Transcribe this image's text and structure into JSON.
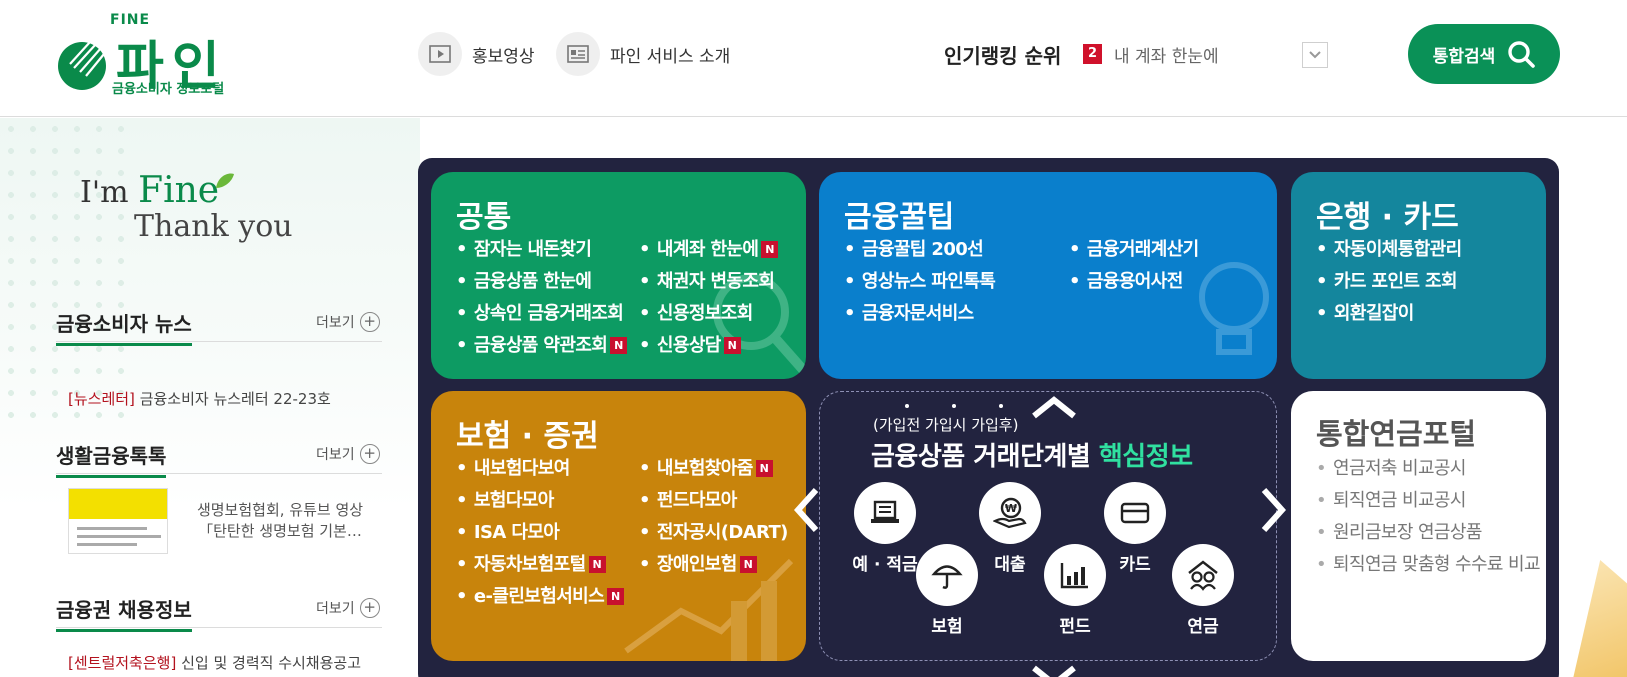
{
  "logo": {
    "top": "FINE",
    "name": "파인",
    "sub": "금융소비자 정보포털"
  },
  "nav": {
    "promo_video": "홍보영상",
    "service_intro": "파인 서비스 소개"
  },
  "ranking": {
    "title": "인기랭킹 순위",
    "num": "2",
    "text": "내 계좌 한눈에"
  },
  "search": {
    "label": "통합검색"
  },
  "slogan": {
    "im": "I'm",
    "fine": "Fine",
    "thanks": "Thank you"
  },
  "news": {
    "title": "금융소비자 뉴스",
    "more": "더보기",
    "item_tag": "[뉴스레터]",
    "item_text": "금융소비자 뉴스레터 22-23호"
  },
  "talk": {
    "title": "생활금융톡톡",
    "more": "더보기",
    "text1": "생명보험협회, 유튜브 영상",
    "text2": "「탄탄한 생명보험 기본…"
  },
  "jobs": {
    "title": "금융권 채용정보",
    "more": "더보기",
    "tag": "[센트럴저축은행]",
    "text": "신입 및 경력직 수시채용공고"
  },
  "cards": {
    "common": {
      "title": "공통",
      "col1": [
        "잠자는 내돈찾기",
        "금융상품 한눈에",
        "상속인 금융거래조회",
        "금융상품 약관조회"
      ],
      "col2": [
        "내계좌 한눈에",
        "채권자 변동조회",
        "신용정보조회",
        "신용상담"
      ]
    },
    "tip": {
      "title": "금융꿀팁",
      "col1": [
        "금융꿀팁 200선",
        "영상뉴스 파인톡톡",
        "금융자문서비스"
      ],
      "col2": [
        "금융거래계산기",
        "금융용어사전"
      ]
    },
    "bank": {
      "title": "은행 · 카드",
      "items": [
        "자동이체통합관리",
        "카드 포인트 조회",
        "외환길잡이"
      ]
    },
    "insurance": {
      "title": "보험 · 증권",
      "col1": [
        "내보험다보여",
        "보험다모아",
        "ISA 다모아",
        "자동차보험포털",
        "e-클린보험서비스"
      ],
      "col2": [
        "내보험찾아줌",
        "펀드다모아",
        "전자공시(DART)",
        "장애인보험"
      ]
    },
    "stage": {
      "sub": "(가입전  가입시  가입후)",
      "title_main": "금융상품 거래단계별 ",
      "title_hl": "핵심정보",
      "items": [
        "예 · 적금",
        "대출",
        "카드",
        "보험",
        "펀드",
        "연금"
      ]
    },
    "pension": {
      "title": "통합연금포털",
      "items": [
        "연금저축 비교공시",
        "퇴직연금 비교공시",
        "원리금보장 연금상품",
        "퇴직연금 맞춤형 수수료 비교"
      ]
    }
  },
  "badge": "N",
  "colors": {
    "brand": "#0a8a4a",
    "common": "#0d9b63",
    "tip": "#0a7fcc",
    "bank": "#14869d",
    "insurance": "#c8840c",
    "panel": "#22233f"
  }
}
